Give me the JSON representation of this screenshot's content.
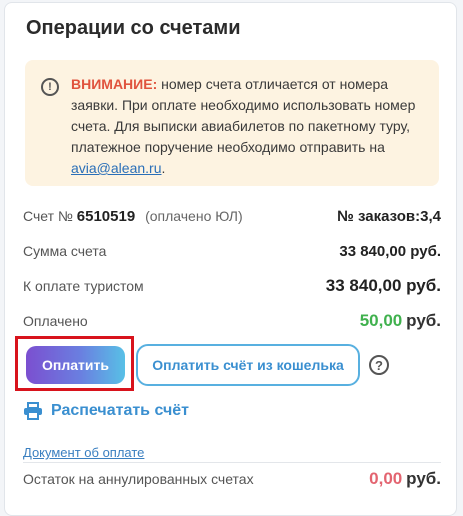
{
  "title": "Операции со счетами",
  "notice": {
    "warning_label": "ВНИМАНИЕ:",
    "text": " номер счета отличается от номера заявки. При оплате необходимо использовать номер счета. Для выписки авиабилетов по пакетному туру, платежное поручение необходимо отправить на ",
    "email": "avia@alean.ru",
    "end": "."
  },
  "account": {
    "label": "Счет №",
    "number": "6510519",
    "paid_note": "(оплачено ЮЛ)",
    "orders": "№ заказов:3,4"
  },
  "rows": {
    "sum_label": "Сумма счета",
    "sum_value": "33 840,00 руб.",
    "tourist_label": "К оплате туристом",
    "tourist_value": "33 840,00 руб.",
    "paid_label": "Оплачено",
    "paid_amount": "50,00",
    "paid_currency": "руб.",
    "canceled_label": "Остаток на аннулированных счетах",
    "canceled_amount": "0,00",
    "canceled_currency": "руб."
  },
  "buttons": {
    "pay": "Оплатить",
    "wallet": "Оплатить счёт из кошелька",
    "help": "?"
  },
  "links": {
    "print": "Распечатать счёт",
    "document": "Документ об оплате"
  },
  "colors": {
    "accent": "#3a8fd0",
    "success": "#40b14e",
    "danger": "#e36470",
    "warning": "#e0533d"
  }
}
